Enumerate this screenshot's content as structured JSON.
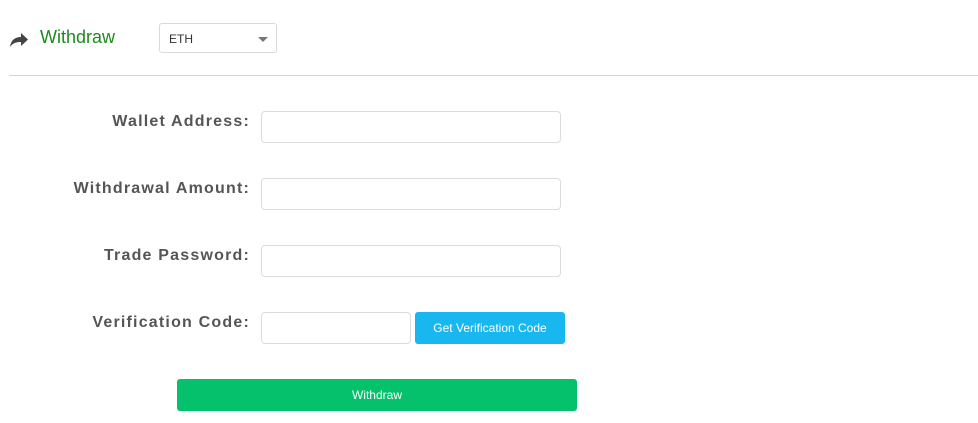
{
  "header": {
    "title": "Withdraw",
    "icon": "share-arrow-icon",
    "title_color": "#1e8a1e",
    "currency_select": {
      "selected": "ETH"
    }
  },
  "form": {
    "wallet_address_label": "Wallet Address:",
    "wallet_address_value": "",
    "amount_label": "Withdrawal Amount:",
    "amount_value": "",
    "trade_password_label": "Trade Password:",
    "trade_password_value": "",
    "verification_code_label": "Verification Code:",
    "verification_code_value": "",
    "get_code_button": "Get Verification Code",
    "submit_button": "Withdraw"
  },
  "colors": {
    "code_button": "#19b7f0",
    "submit_button": "#06c16b"
  }
}
